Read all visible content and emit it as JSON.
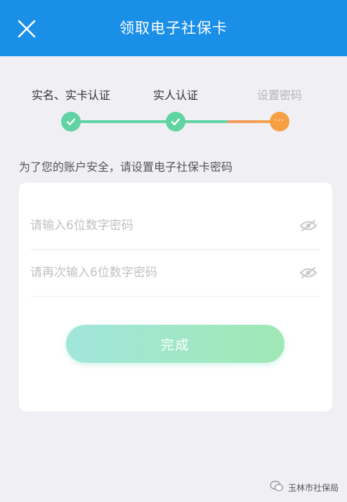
{
  "header": {
    "title": "领取电子社保卡",
    "close_icon": "close-icon"
  },
  "colors": {
    "header_bg": "#1a8fe8",
    "step_done": "#5fd3a1",
    "step_current": "#f6a043",
    "button_gradient": [
      "#a1e6dc",
      "#9fe8b4"
    ]
  },
  "steps": [
    {
      "label": "实名、实卡认证",
      "status": "done",
      "icon": "check-icon"
    },
    {
      "label": "实人认证",
      "status": "done",
      "icon": "check-icon"
    },
    {
      "label": "设置密码",
      "status": "current",
      "icon": "ellipsis-icon"
    }
  ],
  "current_step_marker": "···",
  "notice": "为了您的账户安全，请设置电子社保卡密码",
  "form": {
    "password": {
      "placeholder": "请输入6位数字密码",
      "value": "",
      "icon": "eye-hidden-icon"
    },
    "confirm": {
      "placeholder": "请再次输入6位数字密码",
      "value": "",
      "icon": "eye-hidden-icon"
    },
    "submit_label": "完成"
  },
  "watermark": {
    "text": "玉林市社保局",
    "icon": "wechat-icon"
  }
}
